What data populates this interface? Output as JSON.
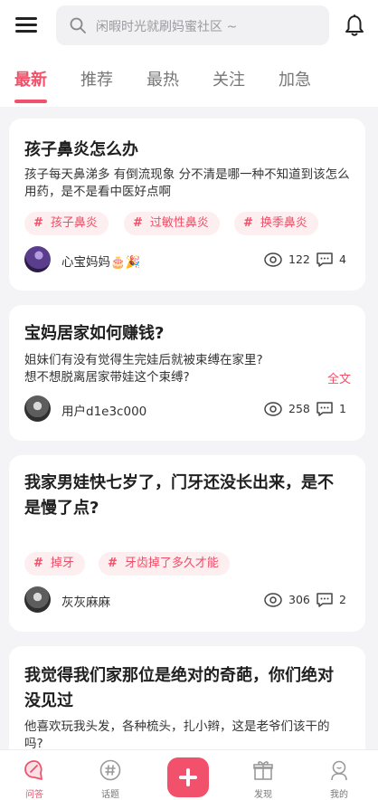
{
  "header": {
    "search_placeholder": "闲暇时光就刷妈蜜社区 ~"
  },
  "tabs": [
    {
      "label": "最新",
      "active": true
    },
    {
      "label": "推荐",
      "active": false
    },
    {
      "label": "最热",
      "active": false
    },
    {
      "label": "关注",
      "active": false
    },
    {
      "label": "加急",
      "active": false
    }
  ],
  "posts": [
    {
      "title": "孩子鼻炎怎么办",
      "body": "孩子每天鼻涕多 有倒流现象 分不清是哪一种不知道到该怎么用药，是不是看中医好点啊",
      "tags": [
        "孩子鼻炎",
        "过敏性鼻炎",
        "换季鼻炎"
      ],
      "author": "心宝妈妈🎂🎉",
      "views": "122",
      "comments": "4"
    },
    {
      "title": "宝妈居家如何赚钱?",
      "body_line1": "姐妹们有没有觉得生完娃后就被束缚在家里?",
      "body_line2": "想不想脱离居家带娃这个束缚?",
      "fulltext_label": "全文",
      "author": "用户d1e3c000",
      "views": "258",
      "comments": "1"
    },
    {
      "title_line1": "我家男娃快七岁了，门牙还没长出来，是不",
      "title_line2": "是慢了点?",
      "tags": [
        "掉牙",
        "牙齿掉了多久才能"
      ],
      "author": "灰灰麻麻",
      "views": "306",
      "comments": "2"
    },
    {
      "title_line1": "我觉得我们家那位是绝对的奇葩，你们绝对",
      "title_line2": "没见过",
      "body_line1": "他喜欢玩我头发，各种梳头，扎小辫，这是老爷们该干的",
      "body_line2": "吗?"
    }
  ],
  "nav": [
    {
      "label": "问答",
      "icon": "qa-bubble-icon",
      "active": true
    },
    {
      "label": "话题",
      "icon": "topic-hash-icon",
      "active": false
    },
    {
      "label": "发现",
      "icon": "gift-icon",
      "active": false
    },
    {
      "label": "我的",
      "icon": "profile-icon",
      "active": false
    }
  ],
  "colors": {
    "accent": "#f1516a",
    "tag_bg": "#fdeef0",
    "page_bg": "#f4f4f6"
  }
}
